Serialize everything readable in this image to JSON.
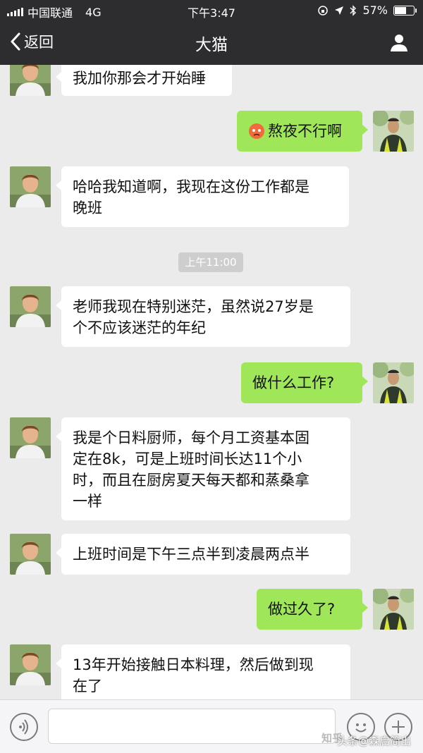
{
  "status_bar": {
    "carrier": "中国联通",
    "network": "4G",
    "time": "下午3:47",
    "battery": "57%"
  },
  "nav": {
    "back_label": "返回",
    "title": "大猫"
  },
  "timestamp": "上午11:00",
  "messages": [
    {
      "side": "left",
      "text": "我加你那会才开始睡"
    },
    {
      "side": "right",
      "text": "熬夜不行啊"
    },
    {
      "side": "left",
      "line1": "哈哈我知道啊，我现在这份工作都是",
      "line2": "晚班"
    },
    {
      "side": "left",
      "line1": "老师我现在特别迷茫，虽然说27岁是",
      "line2": "个不应该迷茫的年纪"
    },
    {
      "side": "right",
      "text": "做什么工作?"
    },
    {
      "side": "left",
      "line1": "我是个日料厨师，每个月工资基本固",
      "line2": "定在8k，可是上班时间长达11个小",
      "line3": "时，而且在厨房夏天每天都和蒸桑拿",
      "line4": "一样"
    },
    {
      "side": "left",
      "text": "上班时间是下午三点半到凌晨两点半"
    },
    {
      "side": "right",
      "text": "做过久了?"
    },
    {
      "side": "left",
      "line1": "13年开始接触日本料理，然后做到现",
      "line2": "在了"
    }
  ],
  "watermark": {
    "site": "知乎",
    "source": "头条@森启简出"
  },
  "colors": {
    "topbar": "#2d2d2f",
    "chat_bg": "#ebebeb",
    "bubble_green": "#9fe658",
    "bubble_white": "#ffffff"
  },
  "icons": [
    "back-chevron-icon",
    "person-icon",
    "voice-icon",
    "emoji-icon",
    "plus-icon",
    "angry-emoji-icon"
  ]
}
